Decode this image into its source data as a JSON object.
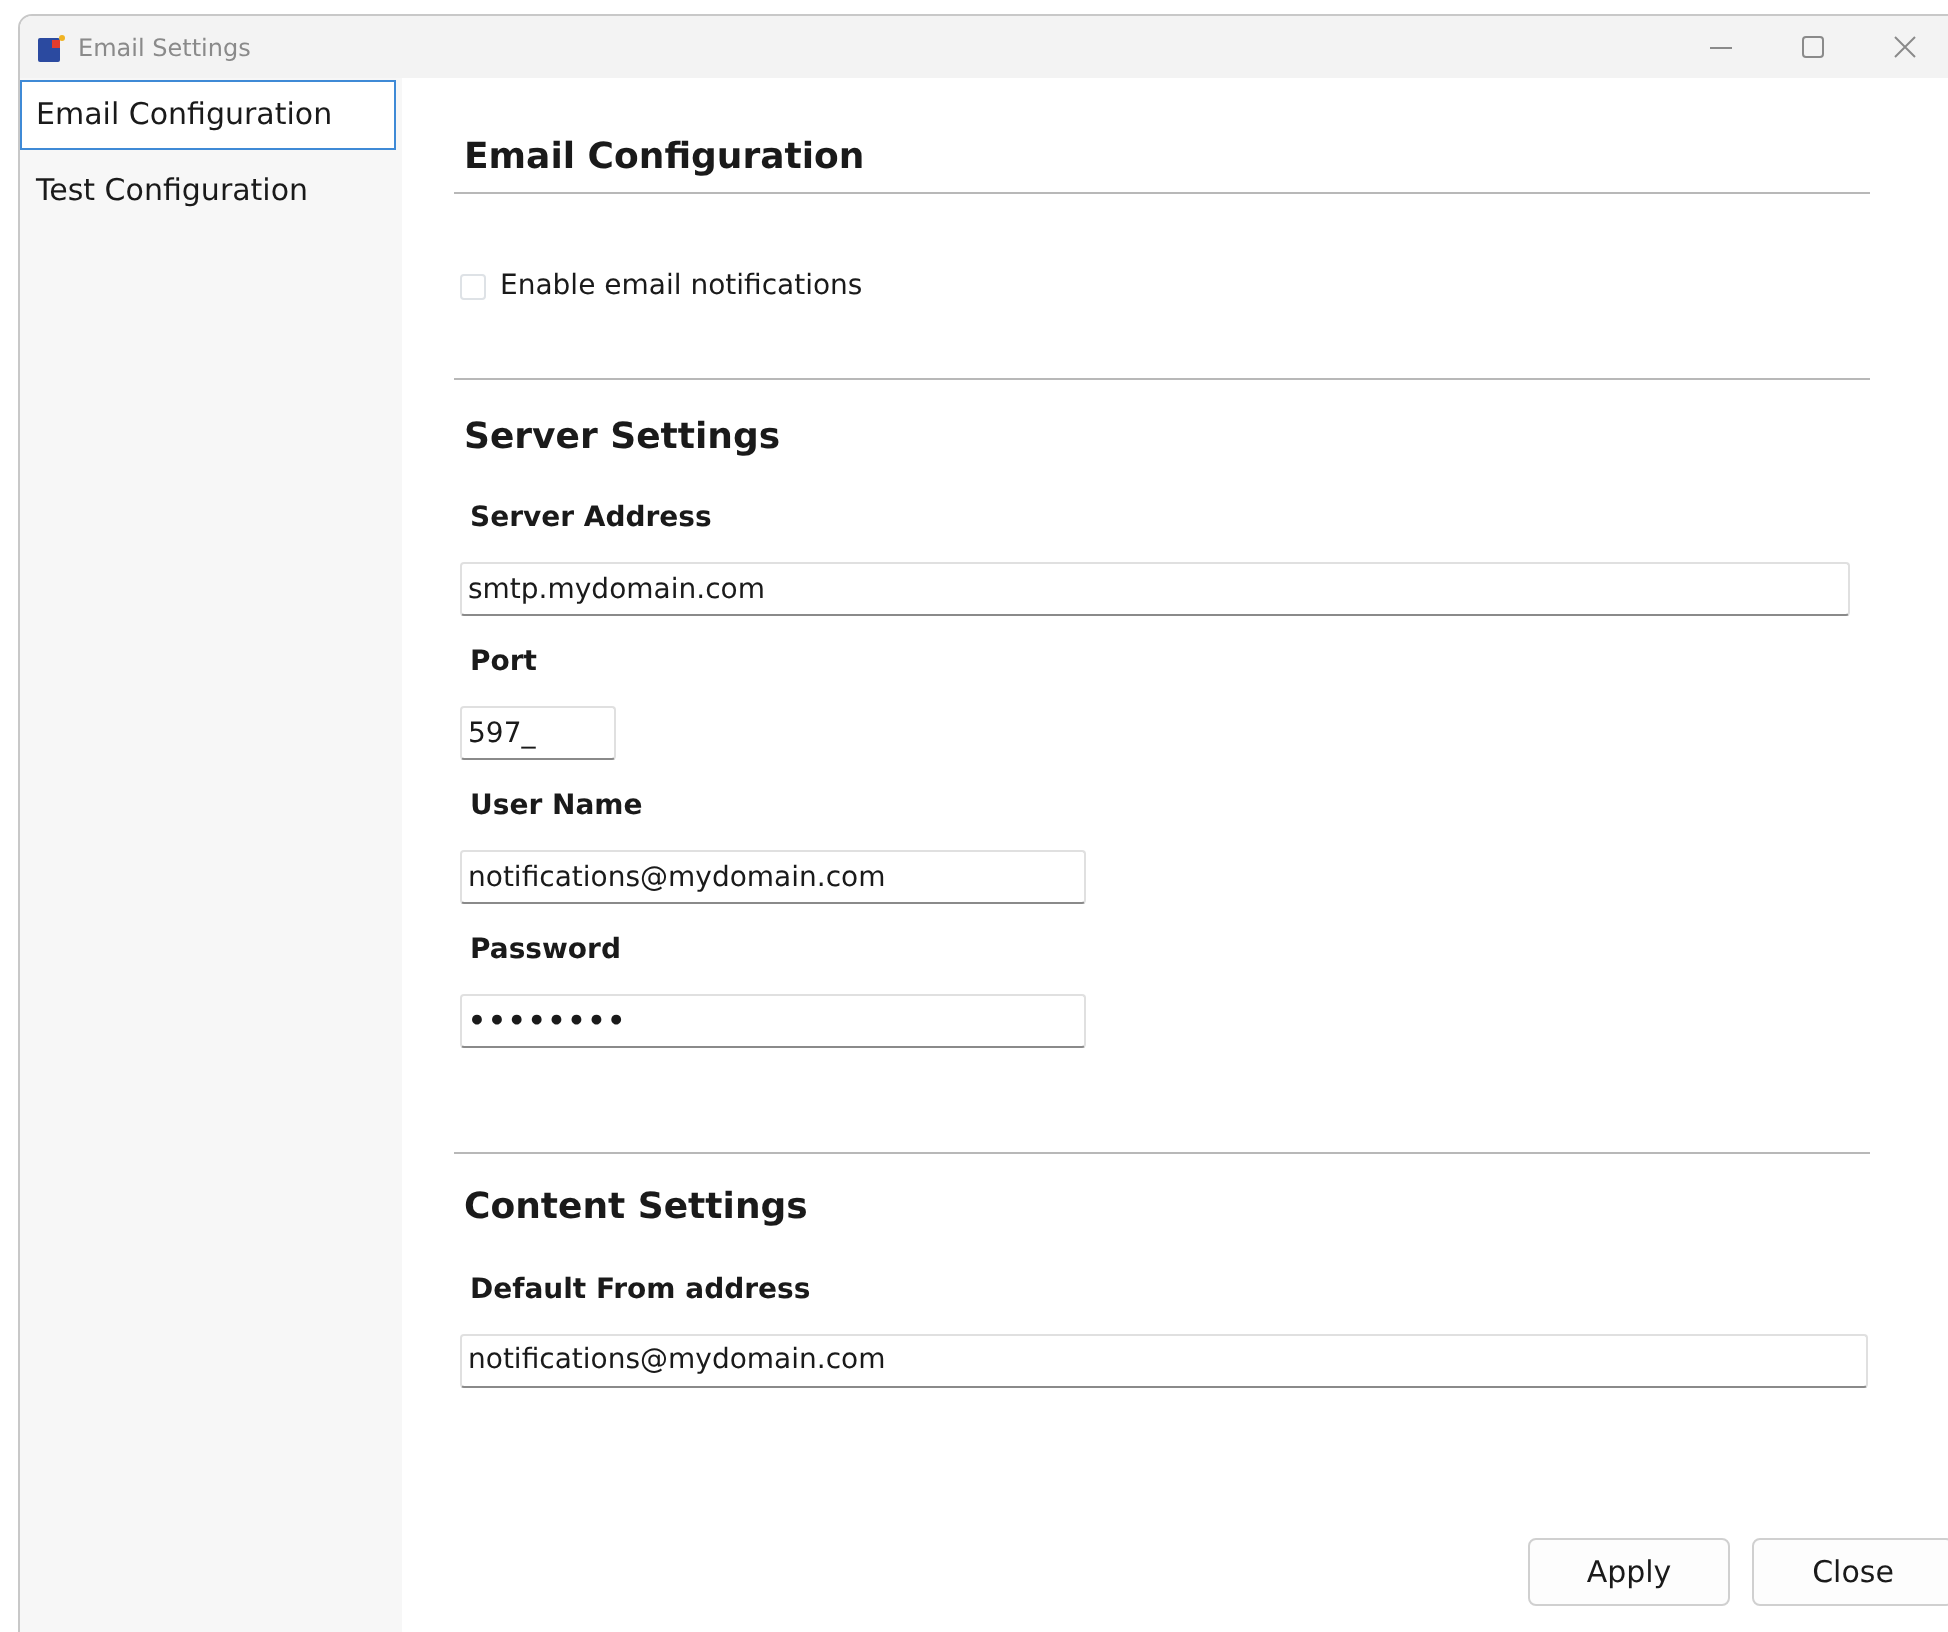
{
  "window": {
    "title": "Email Settings"
  },
  "sidebar": {
    "items": [
      {
        "label": "Email Configuration",
        "selected": true
      },
      {
        "label": "Test Configuration",
        "selected": false
      }
    ]
  },
  "email_configuration": {
    "heading": "Email Configuration",
    "enable_notifications": {
      "label": "Enable email notifications",
      "checked": false
    }
  },
  "server_settings": {
    "heading": "Server Settings",
    "fields": [
      {
        "label": "Server Address",
        "value": "smtp.mydomain.com",
        "kind": "text"
      },
      {
        "label": "Port",
        "value": "597_",
        "kind": "text"
      },
      {
        "label": "User Name",
        "value": "notifications@mydomain.com",
        "kind": "text"
      },
      {
        "label": "Password",
        "value": "••••••••",
        "kind": "password"
      }
    ]
  },
  "content_settings": {
    "heading": "Content Settings",
    "fields": [
      {
        "label": "Default From address",
        "value": "notifications@mydomain.com",
        "kind": "text"
      }
    ]
  },
  "buttons": [
    "Apply",
    "Close"
  ]
}
